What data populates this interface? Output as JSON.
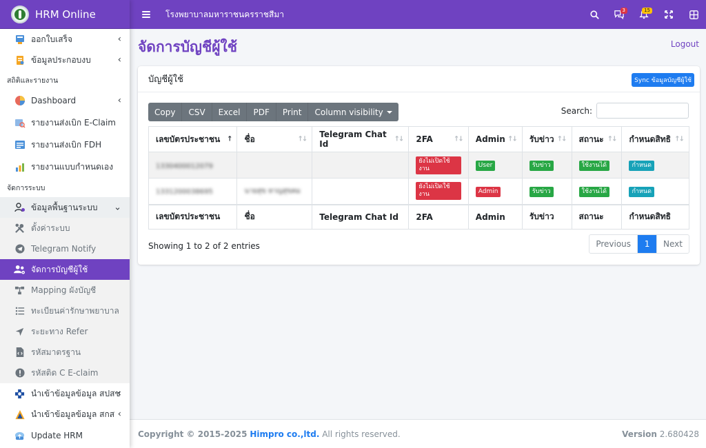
{
  "brand": {
    "name": "HRM Online"
  },
  "topbar": {
    "title": "โรงพยาบาลมหาราชนครราชสีมา",
    "messages_badge": "3",
    "notifications_badge": "15"
  },
  "sidebar": {
    "items_top": [
      {
        "label": "ออกใบเสร็จ"
      },
      {
        "label": "ข้อมูลประกอบงบ"
      }
    ],
    "header_reports": "สถิติและรายงาน",
    "items_reports": [
      {
        "label": "Dashboard"
      },
      {
        "label": "รายงานส่งเบิก E-Claim"
      },
      {
        "label": "รายงานส่งเบิก FDH"
      },
      {
        "label": "รายงานแบบกำหนดเอง"
      }
    ],
    "header_system": "จัดการระบบ",
    "system_parent": "ข้อมูลพื้นฐานระบบ",
    "system_items": [
      {
        "label": "ตั้งค่าระบบ"
      },
      {
        "label": "Telegram Notify"
      },
      {
        "label": "จัดการบัญชีผู้ใช้"
      },
      {
        "label": "Mapping ผังบัญชี"
      },
      {
        "label": "ทะเบียนค่ารักษาพยาบาล"
      },
      {
        "label": "ระยะทาง Refer"
      },
      {
        "label": "รหัสมาตรฐาน"
      },
      {
        "label": "รหัสติด C E-claim"
      }
    ],
    "items_bottom": [
      {
        "label": "นำเข้าข้อมูลข้อมูล สปสช"
      },
      {
        "label": "นำเข้าข้อมูลข้อมูล สกส"
      },
      {
        "label": "Update HRM"
      }
    ]
  },
  "page": {
    "title": "จัดการบัญชีผู้ใช้",
    "logout": "Logout"
  },
  "card": {
    "title": "บัญชีผู้ใช้",
    "sync_button": "Sync ข้อมูลบัญชีผู้ใช้"
  },
  "toolbar": {
    "buttons": [
      "Copy",
      "CSV",
      "Excel",
      "PDF",
      "Print",
      "Column visibility"
    ]
  },
  "search": {
    "label": "Search:",
    "value": ""
  },
  "table": {
    "columns": [
      "เลขบัตรประชาชน",
      "ชื่อ",
      "Telegram Chat Id",
      "2FA",
      "Admin",
      "รับข่าว",
      "สถานะ",
      "กำหนดสิทธิ"
    ],
    "rows": [
      {
        "cid": "1330400012079",
        "name": "",
        "telegram": "",
        "twofa": "ยังไม่เปิดใช้งาน",
        "admin": "User",
        "news": "รับข่าว",
        "status": "ใช้งานได้",
        "perm": "กำหนด"
      },
      {
        "cid": "1331200038695",
        "name": "นายสุข หาญสุขคม",
        "telegram": "",
        "twofa": "ยังไม่เปิดใช้งาน",
        "admin": "Admin",
        "news": "รับข่าว",
        "status": "ใช้งานได้",
        "perm": "กำหนด"
      }
    ],
    "info": "Showing 1 to 2 of 2 entries",
    "pager": {
      "prev": "Previous",
      "current": "1",
      "next": "Next"
    }
  },
  "footer": {
    "copyright": "Copyright © 2015-2025",
    "company": "Himpro co.,ltd.",
    "rights": "All rights reserved.",
    "version_label": "Version",
    "version": "2.680428"
  },
  "colors": {
    "primary": "#6f42c1",
    "blue": "#1e7cf0",
    "danger": "#dc3545",
    "success": "#28a745",
    "info": "#17a2b8"
  }
}
